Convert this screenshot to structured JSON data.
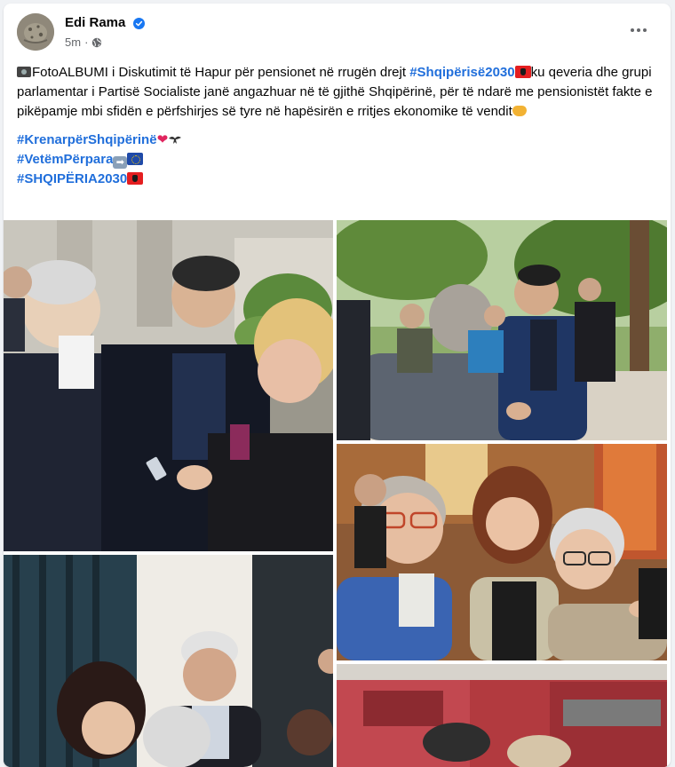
{
  "post": {
    "author": "Edi Rama",
    "time": "5m",
    "separator": "·",
    "text_intro": "FotoALBUMI i Diskutimit të Hapur për pensionet në rrugën drejt ",
    "hashtag_main": "#Shqipërisë2030",
    "text_rest": "ku qeveria dhe grupi parlamentar i Partisë Socialiste janë angazhuar në të gjithë Shqipërinë, për të ndarë me pensionistët fakte e pikëpamje mbi sfidën e përfshirjes së tyre në hapësirën e rritjes ekonomike të vendit",
    "hashtags": [
      "#KrenarpërShqipërinë",
      "#VetëmPërpara",
      "#SHQIPËRIA2030"
    ]
  },
  "icons": {
    "verified": "verified-badge-icon",
    "privacy": "globe-icon",
    "more": "more-options-icon"
  },
  "colors": {
    "hashtag": "#216fdb",
    "verified": "#1877f2",
    "meta": "#65676b"
  }
}
